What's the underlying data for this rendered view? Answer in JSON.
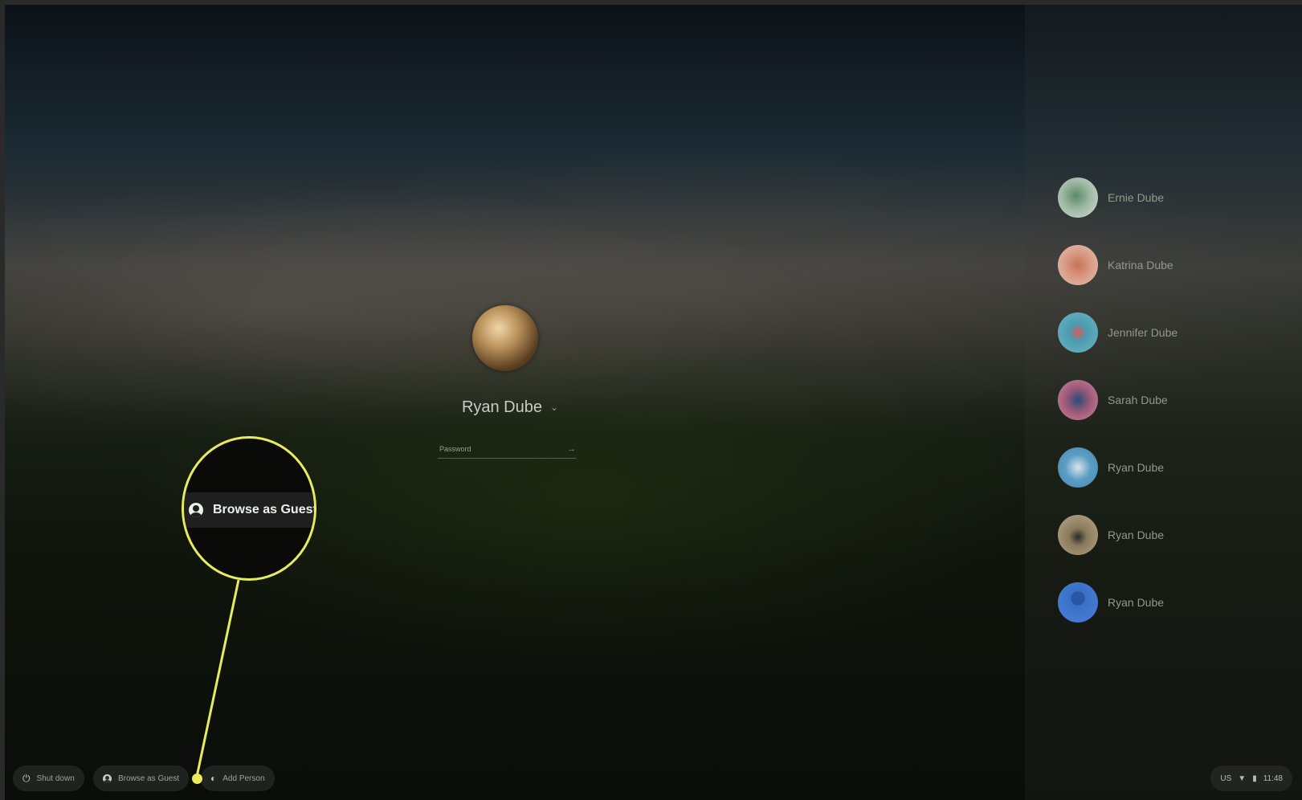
{
  "login": {
    "selected_user": "Ryan Dube",
    "password_placeholder": "Password",
    "submit_glyph": "→"
  },
  "users": [
    {
      "name": "Ernie Dube",
      "avatar_color": "#9fb8a4"
    },
    {
      "name": "Katrina Dube",
      "avatar_color": "#c8735a"
    },
    {
      "name": "Jennifer Dube",
      "avatar_color": "#4a9bb0"
    },
    {
      "name": "Sarah Dube",
      "avatar_color": "#a05a78"
    },
    {
      "name": "Ryan Dube",
      "avatar_color": "#5a9ec4"
    },
    {
      "name": "Ryan Dube",
      "avatar_color": "#8a7a5c"
    },
    {
      "name": "Ryan Dube",
      "avatar_color": "#3a6fc6"
    }
  ],
  "shelf": {
    "shutdown_label": "Shut down",
    "guest_label": "Browse as Guest",
    "add_person_label": "Add Person"
  },
  "status": {
    "locale": "US",
    "time": "11:48"
  },
  "callout": {
    "label": "Browse as Guest",
    "color": "#e8ec5a"
  }
}
